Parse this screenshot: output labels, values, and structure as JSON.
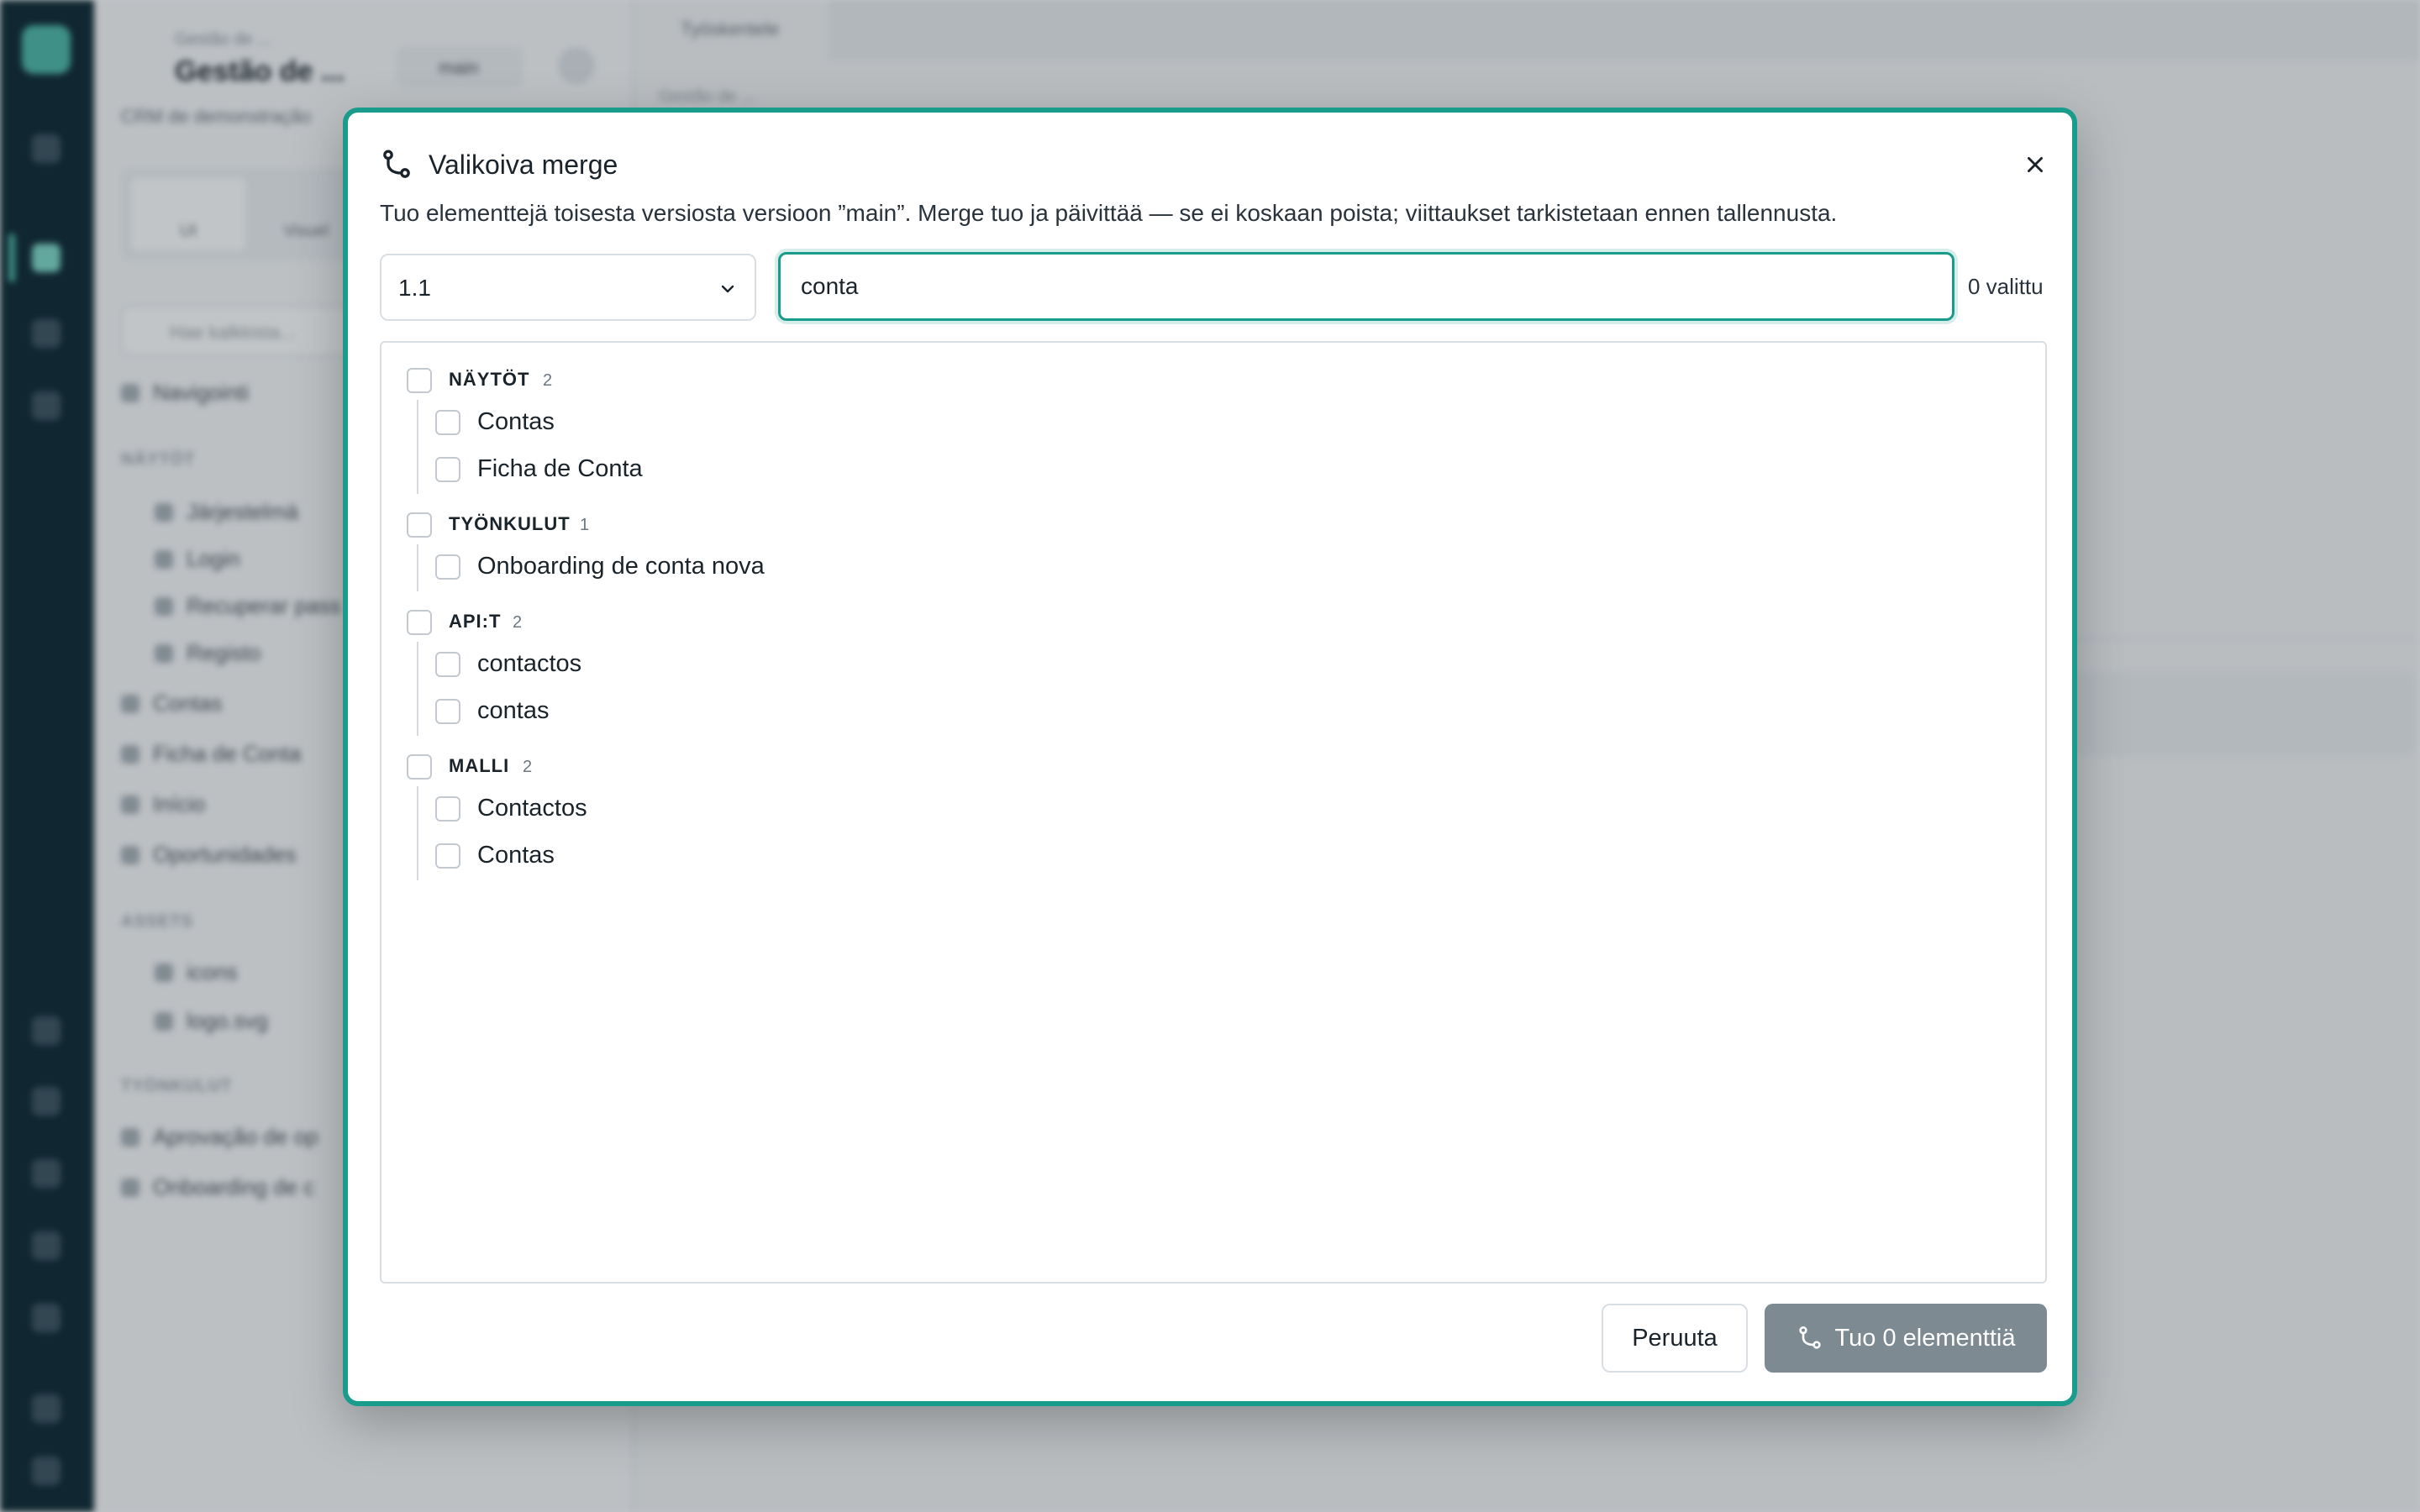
{
  "background": {
    "sidebar": {
      "kicker": "Gestão de ...",
      "title": "Gestão de ...",
      "branch": "main",
      "subtitle": "CRM de demonstração",
      "tabs": [
        "UI",
        "Visuel"
      ],
      "search_placeholder": "Hae kalkkista...",
      "nav_item": "Navigointi",
      "section_views": "NÄYTÖT",
      "views": [
        "Järjestelmä",
        "Login",
        "Recuperar pass",
        "Registo",
        "Contas",
        "Ficha de Conta",
        "Início",
        "Oportunidades"
      ],
      "section_assets": "ASSETS",
      "assets": [
        "icons",
        "logo.svg"
      ],
      "section_workflows": "TYÖNKULUT",
      "workflows": [
        "Aprovação de op",
        "Onboarding de c"
      ]
    },
    "main": {
      "tab": "Työskentele",
      "kicker": "Gestão de ..."
    }
  },
  "modal": {
    "title": "Valikoiva merge",
    "title_icon": "git-merge-icon",
    "close_icon": "close-icon",
    "description": "Tuo elementtejä toisesta versiosta versioon ”main”. Merge tuo ja päivittää — se ei koskaan poista; viittaukset tarkistetaan ennen tallennusta.",
    "source_version": "1.1",
    "search_value": "conta",
    "selected_count": "0 valittu",
    "groups": [
      {
        "label": "NÄYTÖT",
        "count": "2",
        "items": [
          "Contas",
          "Ficha de Conta"
        ]
      },
      {
        "label": "TYÖNKULUT",
        "count": "1",
        "items": [
          "Onboarding de conta nova"
        ]
      },
      {
        "label": "API:T",
        "count": "2",
        "items": [
          "contactos",
          "contas"
        ]
      },
      {
        "label": "MALLI",
        "count": "2",
        "items": [
          "Contactos",
          "Contas"
        ]
      }
    ],
    "cancel_label": "Peruuta",
    "import_label": "Tuo 0 elementtiä",
    "accent_color": "#1a9c8c",
    "import_button_color": "#7e8a92"
  }
}
